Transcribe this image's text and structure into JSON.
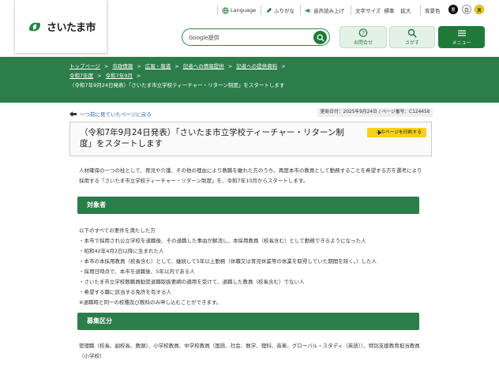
{
  "header": {
    "logo_text": "さいたま市",
    "util_links": [
      "Language",
      "ふりがな",
      "音声読み上げ"
    ],
    "font_size": {
      "label": "文字サイズ",
      "standard": "標準",
      "large": "拡大"
    },
    "bg_color": {
      "label": "背景色",
      "options": [
        "黒",
        "白",
        "黄"
      ]
    },
    "search_placeholder": "Google提供",
    "buttons": {
      "contact": "お問合せ",
      "search": "さがす",
      "menu": "メニュー"
    }
  },
  "breadcrumb": [
    "トップページ",
    "市政情報",
    "広報・報道",
    "記者への情報提供",
    "記者への提供資料",
    "令和7年度",
    "令和7年9月",
    "（令和7年9月24日発表）「さいたま市立学校ティーチャー・リターン制度」をスタートします"
  ],
  "back_link": "一つ前に見ていたページに戻る",
  "meta": "更新日付：2025年9月24日 / ページ番号：C124458",
  "page_title": "（令和7年9月24日発表）「さいたま市立学校ティーチャー・リターン制度」をスタートします",
  "print_label": "このページを印刷する",
  "intro": "人材確保の一つの柱として、育児や介護、その他の理由により教職を離れた方のうち、再度本市の教員として勤務することを希望する方を選考により採用する「さいたま市立学校ティーチャー・リターン制度」を、令和7年10月からスタートします。",
  "section1": {
    "heading": "対象者",
    "lines": [
      "以下のすべての要件を満たした方",
      "・本市で採用され公立学校を退職後、その退職した事由が解消し、本採用教員（校長含む）として勤務できるようになった人",
      "・昭和42年4月2日以降に生まれた人",
      "・本市の本採用教員（校長含む）として、継続して5年以上勤務（休職又は育児休業等の休業を取得していた期間を除く。）した人",
      "・採用日時点で、本市を退職後、5年以内である人",
      "・さいたま市立学校教職員勧奨退職取扱要綱の適用を受けて、退職した教員（校長含む）でない人",
      "・希望する職に該当する免許を有する人",
      "※退職時と同一の校種及び教科のみ申し込むことができます。"
    ]
  },
  "section2": {
    "heading": "募集区分",
    "text": "管理職（校長、副校長、教頭）、小学校教員、中学校教員（国語、社会、数学、理科、音楽、グローバル・スタディ（英語））、特別支援教育担当教員（小学校）"
  },
  "colors": {
    "green": "#2d7d4b",
    "yellow": "#f7d01a",
    "link": "#2b5fa8"
  }
}
